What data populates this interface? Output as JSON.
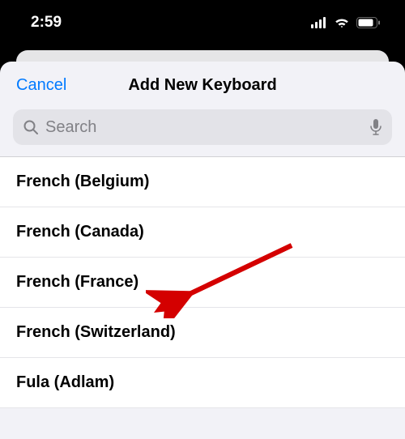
{
  "status": {
    "time": "2:59"
  },
  "sheet": {
    "cancel_label": "Cancel",
    "title": "Add New Keyboard"
  },
  "search": {
    "placeholder": "Search"
  },
  "keyboards": [
    {
      "label": "French (Belgium)"
    },
    {
      "label": "French (Canada)"
    },
    {
      "label": "French (France)"
    },
    {
      "label": "French (Switzerland)"
    },
    {
      "label": "Fula (Adlam)"
    }
  ]
}
